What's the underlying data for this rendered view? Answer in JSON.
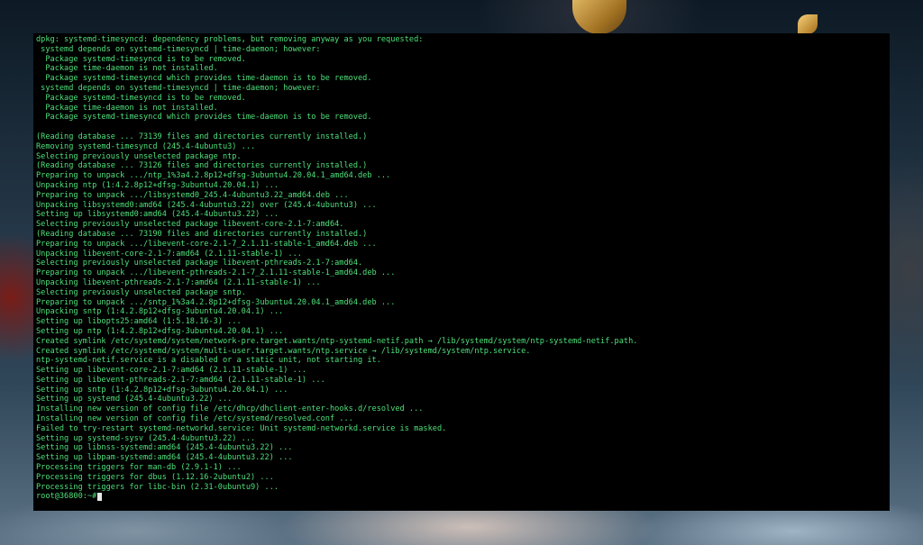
{
  "terminal": {
    "lines": [
      "dpkg: systemd-timesyncd: dependency problems, but removing anyway as you requested:",
      " systemd depends on systemd-timesyncd | time-daemon; however:",
      "  Package systemd-timesyncd is to be removed.",
      "  Package time-daemon is not installed.",
      "  Package systemd-timesyncd which provides time-daemon is to be removed.",
      " systemd depends on systemd-timesyncd | time-daemon; however:",
      "  Package systemd-timesyncd is to be removed.",
      "  Package time-daemon is not installed.",
      "  Package systemd-timesyncd which provides time-daemon is to be removed.",
      "",
      "(Reading database ... 73139 files and directories currently installed.)",
      "Removing systemd-timesyncd (245.4-4ubuntu3) ...",
      "Selecting previously unselected package ntp.",
      "(Reading database ... 73126 files and directories currently installed.)",
      "Preparing to unpack .../ntp_1%3a4.2.8p12+dfsg-3ubuntu4.20.04.1_amd64.deb ...",
      "Unpacking ntp (1:4.2.8p12+dfsg-3ubuntu4.20.04.1) ...",
      "Preparing to unpack .../libsystemd0_245.4-4ubuntu3.22_amd64.deb ...",
      "Unpacking libsystemd0:amd64 (245.4-4ubuntu3.22) over (245.4-4ubuntu3) ...",
      "Setting up libsystemd0:amd64 (245.4-4ubuntu3.22) ...",
      "Selecting previously unselected package libevent-core-2.1-7:amd64.",
      "(Reading database ... 73190 files and directories currently installed.)",
      "Preparing to unpack .../libevent-core-2.1-7_2.1.11-stable-1_amd64.deb ...",
      "Unpacking libevent-core-2.1-7:amd64 (2.1.11-stable-1) ...",
      "Selecting previously unselected package libevent-pthreads-2.1-7:amd64.",
      "Preparing to unpack .../libevent-pthreads-2.1-7_2.1.11-stable-1_amd64.deb ...",
      "Unpacking libevent-pthreads-2.1-7:amd64 (2.1.11-stable-1) ...",
      "Selecting previously unselected package sntp.",
      "Preparing to unpack .../sntp_1%3a4.2.8p12+dfsg-3ubuntu4.20.04.1_amd64.deb ...",
      "Unpacking sntp (1:4.2.8p12+dfsg-3ubuntu4.20.04.1) ...",
      "Setting up libopts25:amd64 (1:5.18.16-3) ...",
      "Setting up ntp (1:4.2.8p12+dfsg-3ubuntu4.20.04.1) ...",
      "Created symlink /etc/systemd/system/network-pre.target.wants/ntp-systemd-netif.path → /lib/systemd/system/ntp-systemd-netif.path.",
      "Created symlink /etc/systemd/system/multi-user.target.wants/ntp.service → /lib/systemd/system/ntp.service.",
      "ntp-systemd-netif.service is a disabled or a static unit, not starting it.",
      "Setting up libevent-core-2.1-7:amd64 (2.1.11-stable-1) ...",
      "Setting up libevent-pthreads-2.1-7:amd64 (2.1.11-stable-1) ...",
      "Setting up sntp (1:4.2.8p12+dfsg-3ubuntu4.20.04.1) ...",
      "Setting up systemd (245.4-4ubuntu3.22) ...",
      "Installing new version of config file /etc/dhcp/dhclient-enter-hooks.d/resolved ...",
      "Installing new version of config file /etc/systemd/resolved.conf ...",
      "Failed to try-restart systemd-networkd.service: Unit systemd-networkd.service is masked.",
      "Setting up systemd-sysv (245.4-4ubuntu3.22) ...",
      "Setting up libnss-systemd:amd64 (245.4-4ubuntu3.22) ...",
      "Setting up libpam-systemd:amd64 (245.4-4ubuntu3.22) ...",
      "Processing triggers for man-db (2.9.1-1) ...",
      "Processing triggers for dbus (1.12.16-2ubuntu2) ...",
      "Processing triggers for libc-bin (2.31-0ubuntu9) ..."
    ],
    "prompt": "root@36800:~#",
    "text_color": "#4ee07a",
    "background_color": "#000000"
  }
}
